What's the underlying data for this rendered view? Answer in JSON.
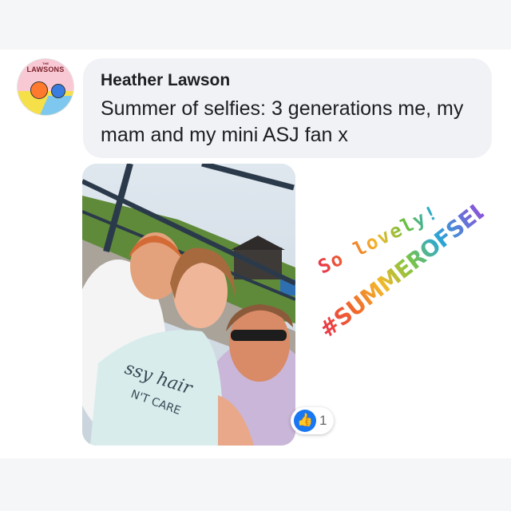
{
  "post": {
    "author": "Heather Lawson",
    "avatar_text": "LAWSONS",
    "avatar_small_text": "THE",
    "message": "Summer of selfies: 3 generations me, my mam and my mini ASJ fan x"
  },
  "photo": {
    "shirt_text_line1": "ssy hair",
    "shirt_text_line2": "N'T CARE"
  },
  "reactions": {
    "icon": "thumbs-up-icon",
    "count": "1"
  },
  "stickers": {
    "lovely": "So lovely!",
    "hashtag": "#SUMMEROFSELFIES"
  },
  "colors": {
    "bubble": "#f0f2f5",
    "like_blue": "#1877f2"
  }
}
